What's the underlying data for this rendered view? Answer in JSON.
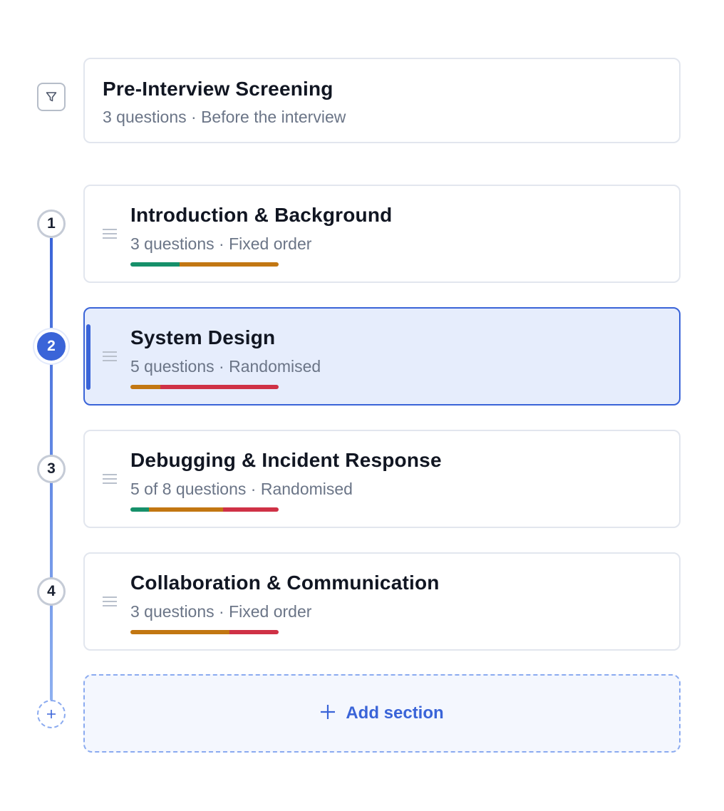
{
  "screening": {
    "title": "Pre-Interview Screening",
    "subtitle": "3 questions · Before the interview",
    "icon": "filter-icon"
  },
  "sections": [
    {
      "step": "1",
      "title": "Introduction & Background",
      "subtitle": "3 questions · Fixed order",
      "selected": false,
      "difficulty": [
        {
          "color": "#16906a",
          "fraction": 0.33
        },
        {
          "color": "#c27712",
          "fraction": 0.67
        }
      ]
    },
    {
      "step": "2",
      "title": "System Design",
      "subtitle": "5 questions · Randomised",
      "selected": true,
      "difficulty": [
        {
          "color": "#c27712",
          "fraction": 0.2
        },
        {
          "color": "#cf3146",
          "fraction": 0.8
        }
      ]
    },
    {
      "step": "3",
      "title": "Debugging & Incident Response",
      "subtitle": "5 of 8 questions · Randomised",
      "selected": false,
      "difficulty": [
        {
          "color": "#16906a",
          "fraction": 0.125
        },
        {
          "color": "#c27712",
          "fraction": 0.5
        },
        {
          "color": "#cf3146",
          "fraction": 0.375
        }
      ]
    },
    {
      "step": "4",
      "title": "Collaboration & Communication",
      "subtitle": "3 questions · Fixed order",
      "selected": false,
      "difficulty": [
        {
          "color": "#c27712",
          "fraction": 0.67
        },
        {
          "color": "#cf3146",
          "fraction": 0.33
        }
      ]
    }
  ],
  "add_section": {
    "label": "Add section",
    "icon": "plus-icon"
  },
  "colors": {
    "accent": "#3a64d8",
    "easy": "#16906a",
    "medium": "#c27712",
    "hard": "#cf3146"
  }
}
